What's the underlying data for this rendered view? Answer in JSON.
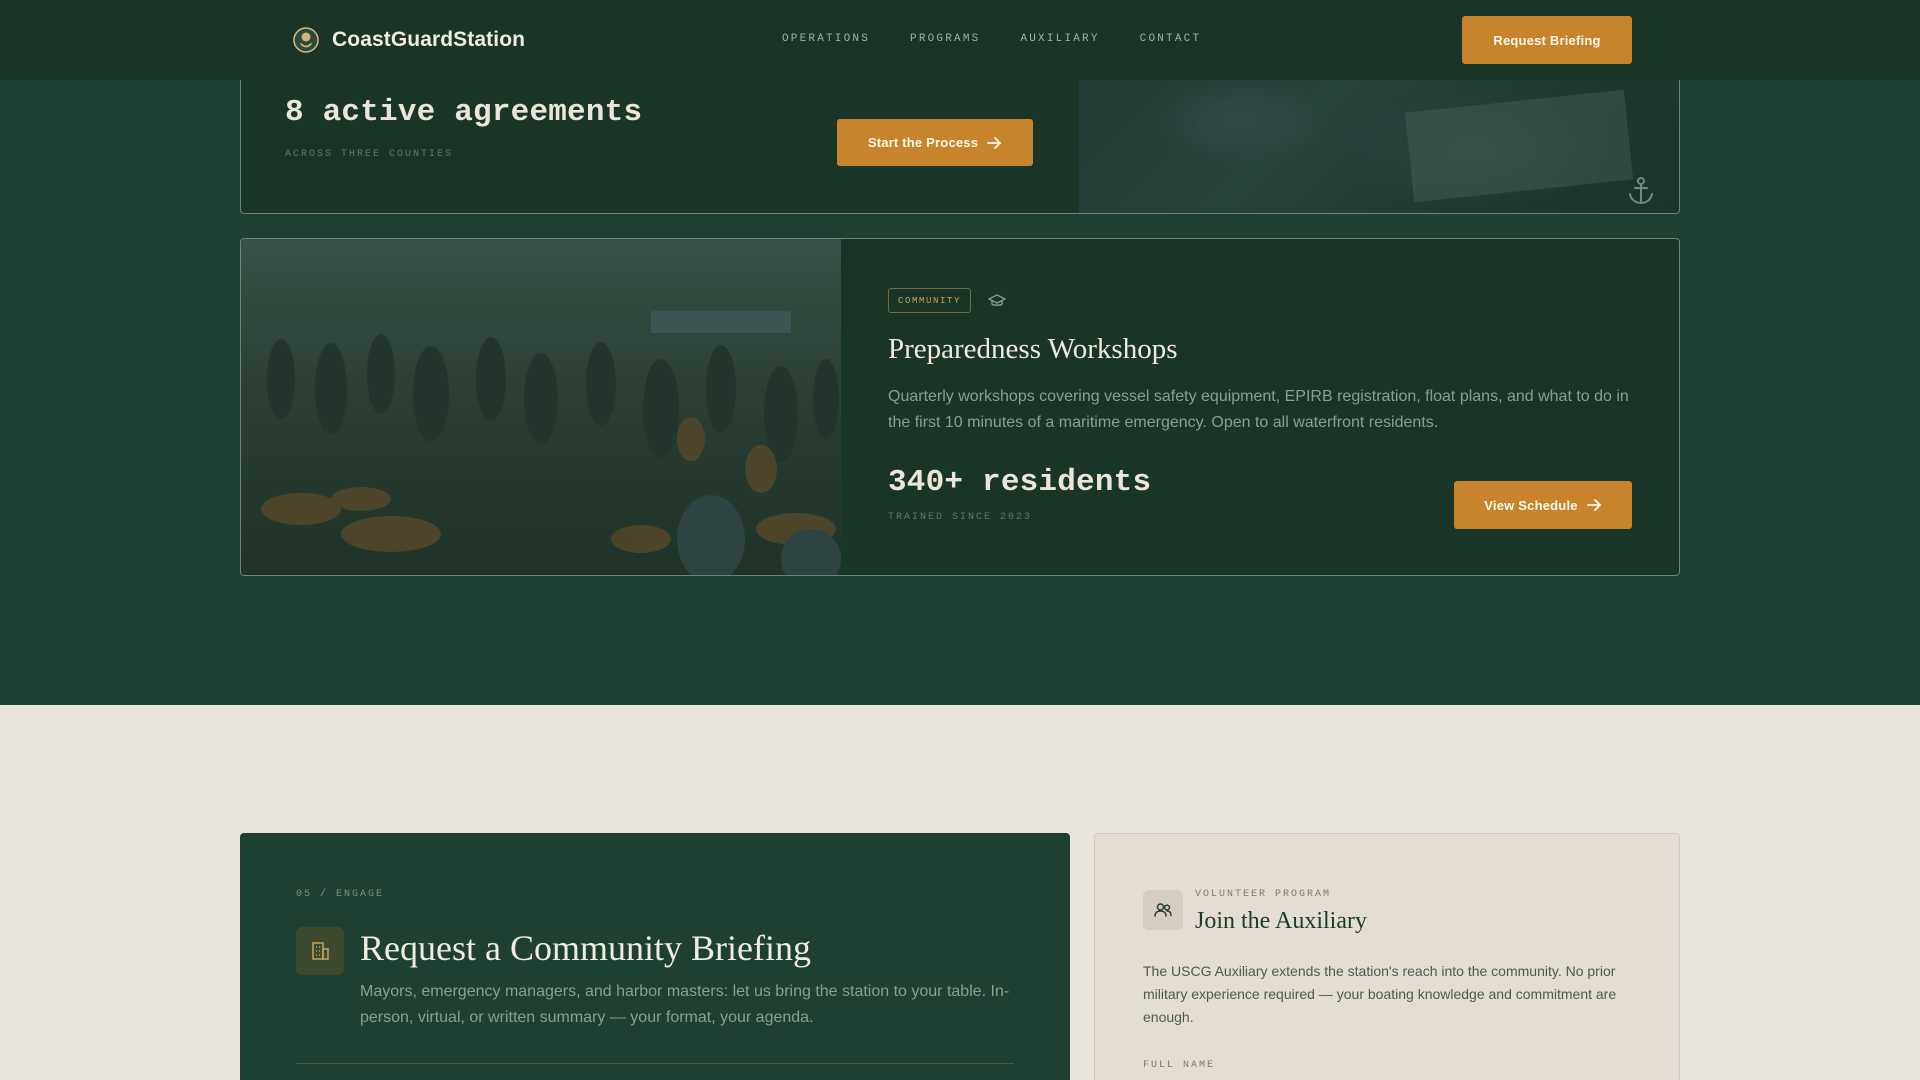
{
  "header": {
    "brand_name": "CoastGuardStation",
    "nav": [
      "OPERATIONS",
      "PROGRAMS",
      "AUXILIARY",
      "CONTACT"
    ],
    "cta_label": "Request Briefing"
  },
  "agreements_card": {
    "stat": "8 active agreements",
    "stat_sub": "ACROSS THREE COUNTIES",
    "cta_label": "Start the Process",
    "photo_icon": "anchor-icon"
  },
  "workshops_card": {
    "tag": "COMMUNITY",
    "tag_icon": "graduation-cap-icon",
    "title": "Preparedness Workshops",
    "description": "Quarterly workshops covering vessel safety equipment, EPIRB registration, float plans, and what to do in the first 10 minutes of a maritime emergency. Open to all waterfront residents.",
    "stat": "340+ residents",
    "stat_sub": "TRAINED SINCE 2023",
    "cta_label": "View Schedule"
  },
  "briefing": {
    "eyebrow": "05 / ENGAGE",
    "icon": "building-icon",
    "title": "Request a Community Briefing",
    "description": "Mayors, emergency managers, and harbor masters: let us bring the station to your table. In-person, virtual, or written summary — your format, your agenda."
  },
  "auxiliary": {
    "icon": "people-icon",
    "eyebrow": "VOLUNTEER PROGRAM",
    "title": "Join the Auxiliary",
    "description": "The USCG Auxiliary extends the station's reach into the community. No prior military experience required — your boating knowledge and commitment are enough.",
    "field_label": "FULL NAME"
  },
  "colors": {
    "forest": "#1d4032",
    "header": "#183527",
    "accent": "#c8842c",
    "cream": "#e8e4dc",
    "brass": "#c8a15c"
  }
}
